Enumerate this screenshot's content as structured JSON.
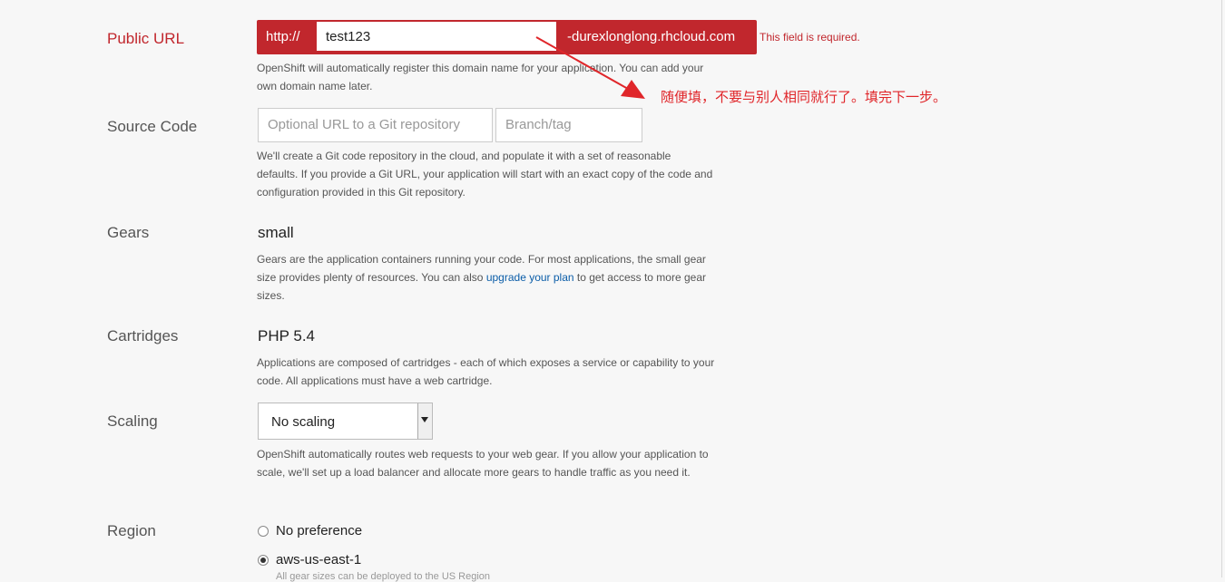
{
  "public_url": {
    "label": "Public URL",
    "prefix": "http://",
    "value": "test123",
    "suffix": "-durexlonglong.rhcloud.com",
    "error": "This field is required.",
    "help": "OpenShift will automatically register this domain name for your application. You can add your own domain name later."
  },
  "annotation": {
    "text": "随便填，不要与别人相同就行了。填完下一步。",
    "color": "#e0262a"
  },
  "source_code": {
    "label": "Source Code",
    "url_placeholder": "Optional URL to a Git repository",
    "branch_placeholder": "Branch/tag",
    "help": "We'll create a Git code repository in the cloud, and populate it with a set of reasonable defaults. If you provide a Git URL, your application will start with an exact copy of the code and configuration provided in this Git repository."
  },
  "gears": {
    "label": "Gears",
    "value": "small",
    "help_pre": "Gears are the application containers running your code. For most applications, the small gear size provides plenty of resources. You can also ",
    "help_link": "upgrade your plan",
    "help_post": " to get access to more gear sizes."
  },
  "cartridges": {
    "label": "Cartridges",
    "value": "PHP 5.4",
    "help": "Applications are composed of cartridges - each of which exposes a service or capability to your code. All applications must have a web cartridge."
  },
  "scaling": {
    "label": "Scaling",
    "selected": "No scaling",
    "help": "OpenShift automatically routes web requests to your web gear. If you allow your application to scale, we'll set up a load balancer and allocate more gears to handle traffic as you need it."
  },
  "region": {
    "label": "Region",
    "options": [
      {
        "label": "No preference",
        "checked": false
      },
      {
        "label": "aws-us-east-1",
        "checked": true
      }
    ],
    "help": "All gear sizes can be deployed to the US Region"
  },
  "colors": {
    "error": "#c1272d",
    "link": "#0b5da8"
  }
}
